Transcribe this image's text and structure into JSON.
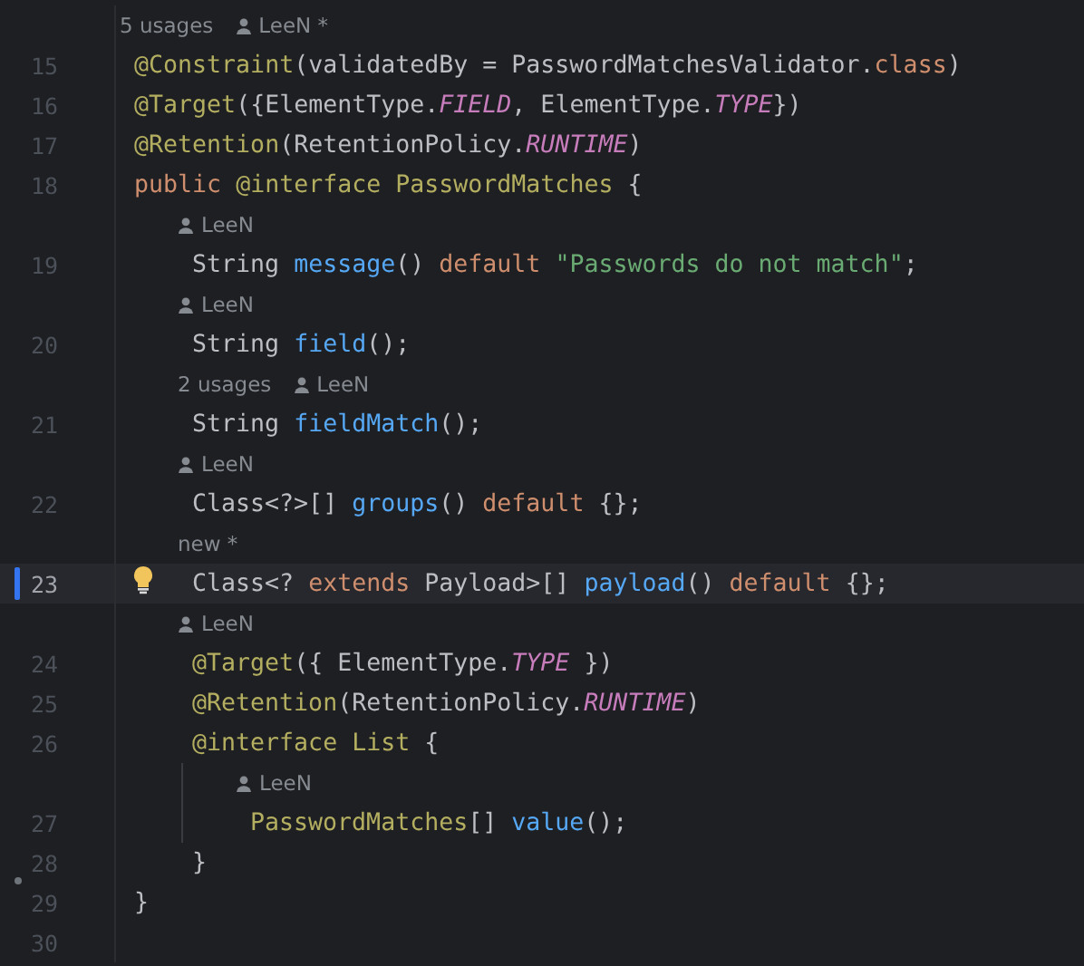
{
  "lines": [
    {
      "kind": "hint",
      "parts": [
        {
          "kind": "usages",
          "text": "5 usages"
        },
        {
          "kind": "author",
          "text": "LeeN *"
        }
      ]
    },
    {
      "kind": "code",
      "number": "15",
      "selected": false,
      "tokens": [
        {
          "kind": "annotation",
          "text": "@Constraint"
        },
        {
          "kind": "plain",
          "text": "(validatedBy = PasswordMatchesValidator."
        },
        {
          "kind": "keyword",
          "text": "class"
        },
        {
          "kind": "plain",
          "text": ")"
        }
      ]
    },
    {
      "kind": "code",
      "number": "16",
      "selected": false,
      "tokens": [
        {
          "kind": "annotation",
          "text": "@Target"
        },
        {
          "kind": "plain",
          "text": "({ElementType."
        },
        {
          "kind": "constant",
          "text": "FIELD"
        },
        {
          "kind": "plain",
          "text": ", ElementType."
        },
        {
          "kind": "constant",
          "text": "TYPE"
        },
        {
          "kind": "plain",
          "text": "})"
        }
      ]
    },
    {
      "kind": "code",
      "number": "17",
      "selected": false,
      "tokens": [
        {
          "kind": "annotation",
          "text": "@Retention"
        },
        {
          "kind": "plain",
          "text": "(RetentionPolicy."
        },
        {
          "kind": "constant",
          "text": "RUNTIME"
        },
        {
          "kind": "plain",
          "text": ")"
        }
      ]
    },
    {
      "kind": "code",
      "number": "18",
      "selected": false,
      "tokens": [
        {
          "kind": "keyword",
          "text": "public"
        },
        {
          "kind": "annotation",
          "text": " @interface PasswordMatches"
        },
        {
          "kind": "plain",
          "text": " {"
        }
      ],
      "children": [
        {
          "kind": "hint",
          "parts": [
            {
              "kind": "author",
              "text": "LeeN"
            }
          ]
        },
        {
          "kind": "code",
          "number": "19",
          "selected": false,
          "tokens": [
            {
              "kind": "plain",
              "text": "String "
            },
            {
              "kind": "method",
              "text": "message"
            },
            {
              "kind": "plain",
              "text": "() "
            },
            {
              "kind": "keyword",
              "text": "default"
            },
            {
              "kind": "string",
              "text": " \"Passwords do not match\""
            },
            {
              "kind": "plain",
              "text": ";"
            }
          ]
        },
        {
          "kind": "hint",
          "parts": [
            {
              "kind": "author",
              "text": "LeeN"
            }
          ]
        },
        {
          "kind": "code",
          "number": "20",
          "selected": false,
          "tokens": [
            {
              "kind": "plain",
              "text": "String "
            },
            {
              "kind": "method",
              "text": "field"
            },
            {
              "kind": "plain",
              "text": "();"
            }
          ]
        },
        {
          "kind": "hint",
          "parts": [
            {
              "kind": "usages",
              "text": "2 usages"
            },
            {
              "kind": "author",
              "text": "LeeN"
            }
          ]
        },
        {
          "kind": "code",
          "number": "21",
          "selected": false,
          "tokens": [
            {
              "kind": "plain",
              "text": "String "
            },
            {
              "kind": "method",
              "text": "fieldMatch"
            },
            {
              "kind": "plain",
              "text": "();"
            }
          ]
        },
        {
          "kind": "hint",
          "parts": [
            {
              "kind": "author",
              "text": "LeeN"
            }
          ]
        },
        {
          "kind": "code",
          "number": "22",
          "selected": false,
          "tokens": [
            {
              "kind": "plain",
              "text": "Class<?>[] "
            },
            {
              "kind": "method",
              "text": "groups"
            },
            {
              "kind": "plain",
              "text": "() "
            },
            {
              "kind": "keyword",
              "text": "default"
            },
            {
              "kind": "plain",
              "text": " {};"
            }
          ]
        },
        {
          "kind": "hint",
          "parts": [
            {
              "kind": "usages",
              "text": "new *"
            }
          ]
        },
        {
          "kind": "code",
          "number": "23",
          "selected": true,
          "intention": true,
          "tokens": [
            {
              "kind": "plain",
              "text": "Class<? "
            },
            {
              "kind": "keyword",
              "text": "extends"
            },
            {
              "kind": "plain",
              "text": " Payload>[] "
            },
            {
              "kind": "method",
              "text": "payload"
            },
            {
              "kind": "plain",
              "text": "() "
            },
            {
              "kind": "keyword",
              "text": "default"
            },
            {
              "kind": "plain",
              "text": " {};"
            }
          ]
        },
        {
          "kind": "hint",
          "parts": [
            {
              "kind": "author",
              "text": "LeeN"
            }
          ]
        },
        {
          "kind": "code",
          "number": "24",
          "selected": false,
          "tokens": [
            {
              "kind": "annotation",
              "text": "@Target"
            },
            {
              "kind": "plain",
              "text": "({ ElementType."
            },
            {
              "kind": "constant",
              "text": "TYPE"
            },
            {
              "kind": "plain",
              "text": " })"
            }
          ]
        },
        {
          "kind": "code",
          "number": "25",
          "selected": false,
          "tokens": [
            {
              "kind": "annotation",
              "text": "@Retention"
            },
            {
              "kind": "plain",
              "text": "(RetentionPolicy."
            },
            {
              "kind": "constant",
              "text": "RUNTIME"
            },
            {
              "kind": "plain",
              "text": ")"
            }
          ]
        },
        {
          "kind": "code",
          "number": "26",
          "selected": false,
          "tokens": [
            {
              "kind": "annotation",
              "text": "@interface List"
            },
            {
              "kind": "plain",
              "text": " {"
            }
          ],
          "children": [
            {
              "kind": "hint",
              "parts": [
                {
                  "kind": "author",
                  "text": "LeeN"
                }
              ]
            },
            {
              "kind": "code",
              "number": "27",
              "selected": false,
              "tokens": [
                {
                  "kind": "annotation",
                  "text": "PasswordMatches"
                },
                {
                  "kind": "plain",
                  "text": "[] "
                },
                {
                  "kind": "method",
                  "text": "value"
                },
                {
                  "kind": "plain",
                  "text": "();"
                }
              ]
            }
          ]
        },
        {
          "kind": "code",
          "number": "28",
          "selected": false,
          "gutter_dot": true,
          "tokens": [
            {
              "kind": "plain",
              "text": "}"
            }
          ]
        }
      ]
    },
    {
      "kind": "code",
      "number": "29",
      "selected": false,
      "tokens": [
        {
          "kind": "plain",
          "text": "}"
        }
      ]
    },
    {
      "kind": "code",
      "number": "30",
      "selected": false
    }
  ]
}
